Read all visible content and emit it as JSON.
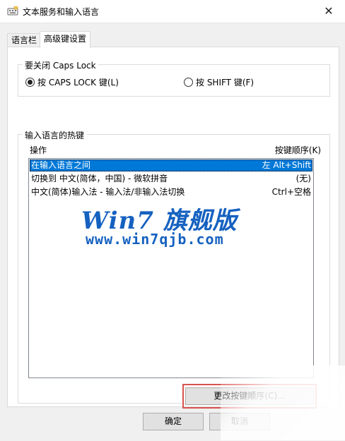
{
  "window": {
    "title": "文本服务和输入语言",
    "close_glyph": "✕"
  },
  "tabs": [
    {
      "label": "语言栏"
    },
    {
      "label": "高级键设置"
    }
  ],
  "capslock": {
    "legend": "要关闭 Caps Lock",
    "option1": "按 CAPS LOCK 键(L)",
    "option2": "按 SHIFT 键(F)"
  },
  "hotkeys": {
    "legend": "输入语言的热键",
    "col_action": "操作",
    "col_sequence": "按键顺序(K)",
    "rows": [
      {
        "action": "在输入语言之间",
        "sequence": "左 Alt+Shift"
      },
      {
        "action": "切换到 中文(简体，中国) - 微软拼音",
        "sequence": "(无)"
      },
      {
        "action": "中文(简体)输入法 - 输入法/非输入法切换",
        "sequence": "Ctrl+空格"
      }
    ]
  },
  "watermark": {
    "line1": "Win7 旗舰版",
    "line2": "www.win7qjb.com"
  },
  "buttons": {
    "change_sequence": "更改按键顺序(C)...",
    "ok": "确定",
    "cancel": "取消"
  },
  "colors": {
    "selection": "#0078d7",
    "highlight": "#d9534f",
    "watermark": "#1561c0"
  }
}
